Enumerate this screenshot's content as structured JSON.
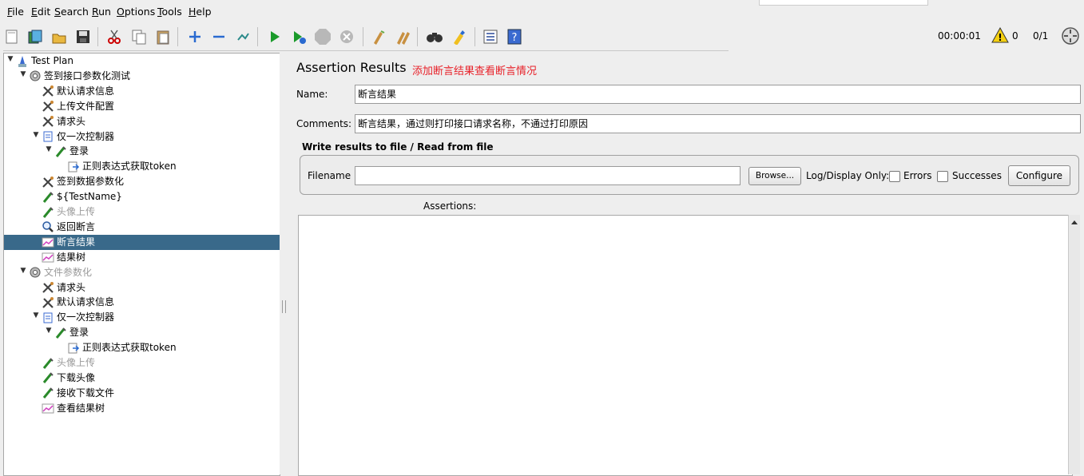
{
  "menu": [
    {
      "mn": "F",
      "rest": "ile"
    },
    {
      "mn": "E",
      "rest": "dit"
    },
    {
      "mn": "S",
      "rest": "earch"
    },
    {
      "mn": "R",
      "rest": "un"
    },
    {
      "mn": "O",
      "rest": "ptions"
    },
    {
      "mn": "T",
      "rest": "ools"
    },
    {
      "mn": "H",
      "rest": "elp"
    }
  ],
  "toolbar": {
    "icons": [
      "new-icon",
      "templates-icon",
      "open-icon",
      "save-icon",
      "cut-icon",
      "copy-icon",
      "paste-icon",
      "expand-icon",
      "collapse-icon",
      "toggle-icon",
      "start-icon",
      "start-no-pause-icon",
      "stop-icon",
      "shutdown-icon",
      "clear-icon",
      "clear-all-icon",
      "search-icon",
      "reset-search-icon",
      "function-helper-icon",
      "help-icon"
    ],
    "timer": "00:00:01",
    "warnings": "0",
    "threads": "0/1"
  },
  "tree": [
    {
      "label": "Test Plan",
      "icon": "test-plan-icon",
      "disabled": false
    },
    {
      "label": "签到接口参数化测试",
      "icon": "thread-group-icon",
      "disabled": false
    },
    {
      "label": "默认请求信息",
      "icon": "config-element-icon",
      "disabled": false
    },
    {
      "label": "上传文件配置",
      "icon": "config-element-icon",
      "disabled": false
    },
    {
      "label": "请求头",
      "icon": "config-element-icon",
      "disabled": false
    },
    {
      "label": "仅一次控制器",
      "icon": "controller-icon",
      "disabled": false
    },
    {
      "label": "登录",
      "icon": "sampler-icon",
      "disabled": false
    },
    {
      "label": "正则表达式获取token",
      "icon": "post-processor-icon",
      "disabled": false
    },
    {
      "label": "签到数据参数化",
      "icon": "config-element-icon",
      "disabled": false
    },
    {
      "label": "${TestName}",
      "icon": "sampler-icon",
      "disabled": false
    },
    {
      "label": "头像上传",
      "icon": "sampler-icon",
      "disabled": true
    },
    {
      "label": "返回断言",
      "icon": "assertion-icon",
      "disabled": false
    },
    {
      "label": "断言结果",
      "icon": "listener-icon",
      "disabled": false
    },
    {
      "label": "结果树",
      "icon": "listener-icon",
      "disabled": false
    },
    {
      "label": "文件参数化",
      "icon": "thread-group-icon",
      "disabled": true
    },
    {
      "label": "请求头",
      "icon": "config-element-icon",
      "disabled": false
    },
    {
      "label": "默认请求信息",
      "icon": "config-element-icon",
      "disabled": false
    },
    {
      "label": "仅一次控制器",
      "icon": "controller-icon",
      "disabled": false
    },
    {
      "label": "登录",
      "icon": "sampler-icon",
      "disabled": false
    },
    {
      "label": "正则表达式获取token",
      "icon": "post-processor-icon",
      "disabled": false
    },
    {
      "label": "头像上传",
      "icon": "sampler-icon",
      "disabled": true
    },
    {
      "label": "下载头像",
      "icon": "sampler-icon",
      "disabled": false
    },
    {
      "label": "接收下载文件",
      "icon": "sampler-icon",
      "disabled": false
    },
    {
      "label": "查看结果树",
      "icon": "listener-icon",
      "disabled": false
    }
  ],
  "panel": {
    "title": "Assertion Results",
    "note": "添加断言结果查看断言情况",
    "name_label": "Name:",
    "name_value": "断言结果",
    "comments_label": "Comments:",
    "comments_value": "断言结果，通过则打印接口请求名称，不通过打印原因",
    "file_group_title": "Write results to file / Read from file",
    "filename_label": "Filename",
    "filename_value": "",
    "browse_label": "Browse...",
    "log_display_label": "Log/Display Only:",
    "errors_label": "Errors",
    "successes_label": "Successes",
    "configure_label": "Configure",
    "assertions_label": "Assertions:"
  },
  "colors": {
    "selection": "#39698a",
    "note": "#e8222a"
  }
}
